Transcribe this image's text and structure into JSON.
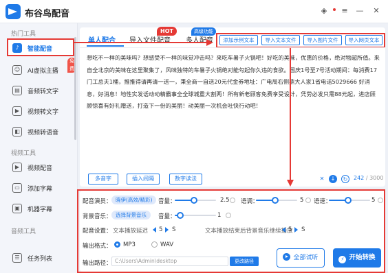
{
  "app": {
    "title": "布谷鸟配音"
  },
  "sidebar": {
    "section_hot": "热门工具",
    "section_video": "视频工具",
    "section_audio": "音频工具",
    "items": [
      {
        "label": "智能配音",
        "icon": "mic-icon"
      },
      {
        "label": "AI虚拟主播",
        "icon": "robot-icon",
        "badge": "免费"
      },
      {
        "label": "音频转文字",
        "icon": "audio-text-icon"
      },
      {
        "label": "视频转文字",
        "icon": "video-text-icon"
      },
      {
        "label": "视频转语音",
        "icon": "video-voice-icon"
      },
      {
        "label": "视频配音",
        "icon": "video-dub-icon"
      },
      {
        "label": "添加字幕",
        "icon": "subtitle-icon"
      },
      {
        "label": "机器字幕",
        "icon": "machine-subtitle-icon"
      },
      {
        "label": "任务列表",
        "icon": "task-list-icon"
      }
    ]
  },
  "tabs": {
    "single": "单人配合",
    "import": "导入文件配音",
    "hot_badge": "HOT",
    "pro_badge": "高级功能",
    "multi": "多人配音"
  },
  "toolbar": {
    "add_example": "添加示例文本",
    "import_text": "导入文本文件",
    "import_image": "导入图片文件",
    "import_web": "导入网页文本"
  },
  "editor": {
    "text": "想吃不一样的美味吗？想感受不一样的味觉冲击吗？来吃车暑子火锅吧！好吃的美味，优惠的价格，绝对物超所值。来自全北京的美味在这里聚集了，风味独特的车暑子火锅绝对能勾起你久违的食欲。国庆1号至7号活动期间：每消费17门工总夫1桶，推推得请再请一送一，秉全商一自送20元代金券地址：广电局右侧鼎大人家1省电话5029666 好消息，好消息！地性实发话动动精霸事全全球城重大割两！所有新老顾客免费享受设计，凭劳必发只需88元起，进店顾顾惊喜有好礼赠送，打造下一份的美丽！动美丽一次机会吐快行动吧！"
  },
  "editor_bottom": {
    "polyphone": "多音字",
    "insert_pause": "插入间隔",
    "number_read": "数字读法",
    "counter_value": "242",
    "counter_max": "/ 3000"
  },
  "settings": {
    "voice_label": "配音演员：",
    "voice_value": "晓伊(高效/精彩)",
    "volume_label": "音量：",
    "volume_value": "2.5",
    "speed_label": "语调：",
    "speed_value": "5",
    "pitch_label": "语速：",
    "pitch_value": "5",
    "bgm_label": "背景音乐：",
    "bgm_value": "选择背景音乐",
    "bgm_volume_label": "音量：",
    "bgm_volume_value": "1",
    "setting_label": "配音设置：",
    "delay_label": "文本播放延迟",
    "delay_value": "5",
    "delay_unit": "S",
    "tail_label": "文本播放结束后背景音乐继续播放",
    "tail_value": "5",
    "tail_unit": "S",
    "format_label": "输出格式：",
    "format_mp3": "MP3",
    "format_wav": "WAV",
    "path_label": "输出路径：",
    "path_value": "C:\\Users\\Admin\\desktop",
    "path_btn": "更改路径",
    "preview_btn": "全部试听",
    "start_btn": "开始转换"
  },
  "colors": {
    "accent": "#1f7ae8",
    "annotation": "#e53935"
  }
}
